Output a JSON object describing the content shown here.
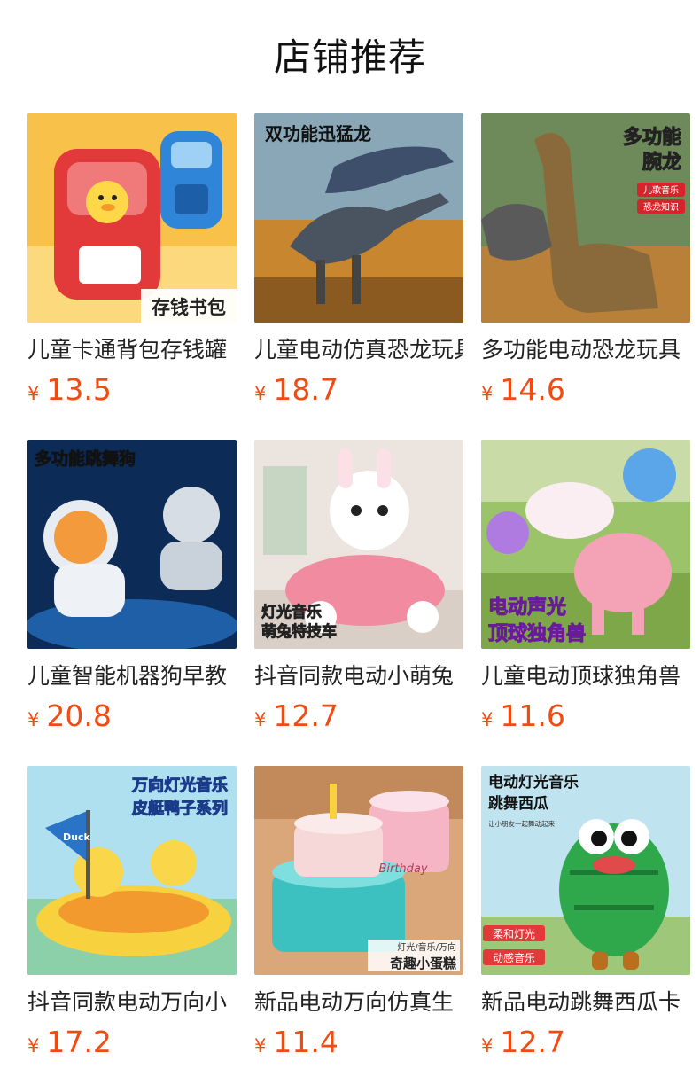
{
  "page": {
    "title": "店铺推荐"
  },
  "currency_symbol": "¥",
  "products": [
    {
      "name": "儿童卡通背包存钱罐",
      "price": "13.5",
      "image_text": [
        "存钱书包"
      ]
    },
    {
      "name": "儿童电动仿真恐龙玩具",
      "price": "18.7",
      "image_text": [
        "双功能迅猛龙"
      ]
    },
    {
      "name": "多功能电动恐龙玩具",
      "price": "14.6",
      "image_text": [
        "多功能",
        "腕龙",
        "儿歌音乐",
        "恐龙知识"
      ]
    },
    {
      "name": "儿童智能机器狗早教",
      "price": "20.8",
      "image_text": [
        "多功能跳舞狗"
      ]
    },
    {
      "name": "抖音同款电动小萌兔",
      "price": "12.7",
      "image_text": [
        "灯光音乐",
        "萌兔特技车"
      ]
    },
    {
      "name": "儿童电动顶球独角兽",
      "price": "11.6",
      "image_text": [
        "电动声光",
        "顶球独角兽"
      ]
    },
    {
      "name": "抖音同款电动万向小",
      "price": "17.2",
      "image_text": [
        "万向灯光音乐",
        "皮艇鸭子系列",
        "Duck"
      ]
    },
    {
      "name": "新品电动万向仿真生",
      "price": "11.4",
      "image_text": [
        "灯光/音乐/万向",
        "奇趣小蛋糕",
        "Birthday"
      ]
    },
    {
      "name": "新品电动跳舞西瓜卡",
      "price": "12.7",
      "image_text": [
        "电动灯光音乐",
        "跳舞西瓜",
        "让小朋友一起舞动起来!",
        "柔和灯光",
        "动感音乐"
      ]
    }
  ]
}
